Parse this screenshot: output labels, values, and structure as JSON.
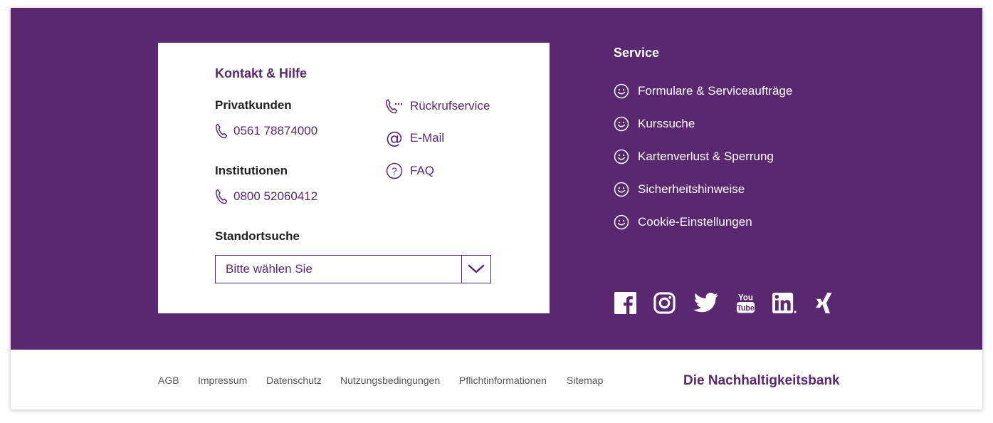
{
  "contact": {
    "title": "Kontakt & Hilfe",
    "private_label": "Privatkunden",
    "private_phone": "0561 78874000",
    "institutions_label": "Institutionen",
    "institutions_phone": "0800 52060412",
    "location_label": "Standortsuche",
    "location_select": "Bitte wählen Sie",
    "links": {
      "callback": "Rückrufservice",
      "email": "E-Mail",
      "faq": "FAQ"
    }
  },
  "service": {
    "title": "Service",
    "items": [
      {
        "label": "Formulare & Serviceaufträge",
        "icon": "smiley-icon"
      },
      {
        "label": "Kurssuche",
        "icon": "smiley-icon"
      },
      {
        "label": "Kartenverlust & Sperrung",
        "icon": "smiley-icon"
      },
      {
        "label": "Sicherheitshinweise",
        "icon": "smiley-icon"
      },
      {
        "label": "Cookie-Einstellungen",
        "icon": "smiley-icon"
      }
    ]
  },
  "social": [
    "facebook-icon",
    "instagram-icon",
    "twitter-icon",
    "youtube-icon",
    "linkedin-icon",
    "xing-icon"
  ],
  "footer": {
    "links": [
      "AGB",
      "Impressum",
      "Datenschutz",
      "Nutzungsbedingungen",
      "Pflichtinformationen",
      "Sitemap"
    ],
    "tagline": "Die Nachhaltigkeitsbank"
  },
  "colors": {
    "brand_purple": "#5a2871",
    "white": "#ffffff",
    "footer_text": "#555555"
  }
}
